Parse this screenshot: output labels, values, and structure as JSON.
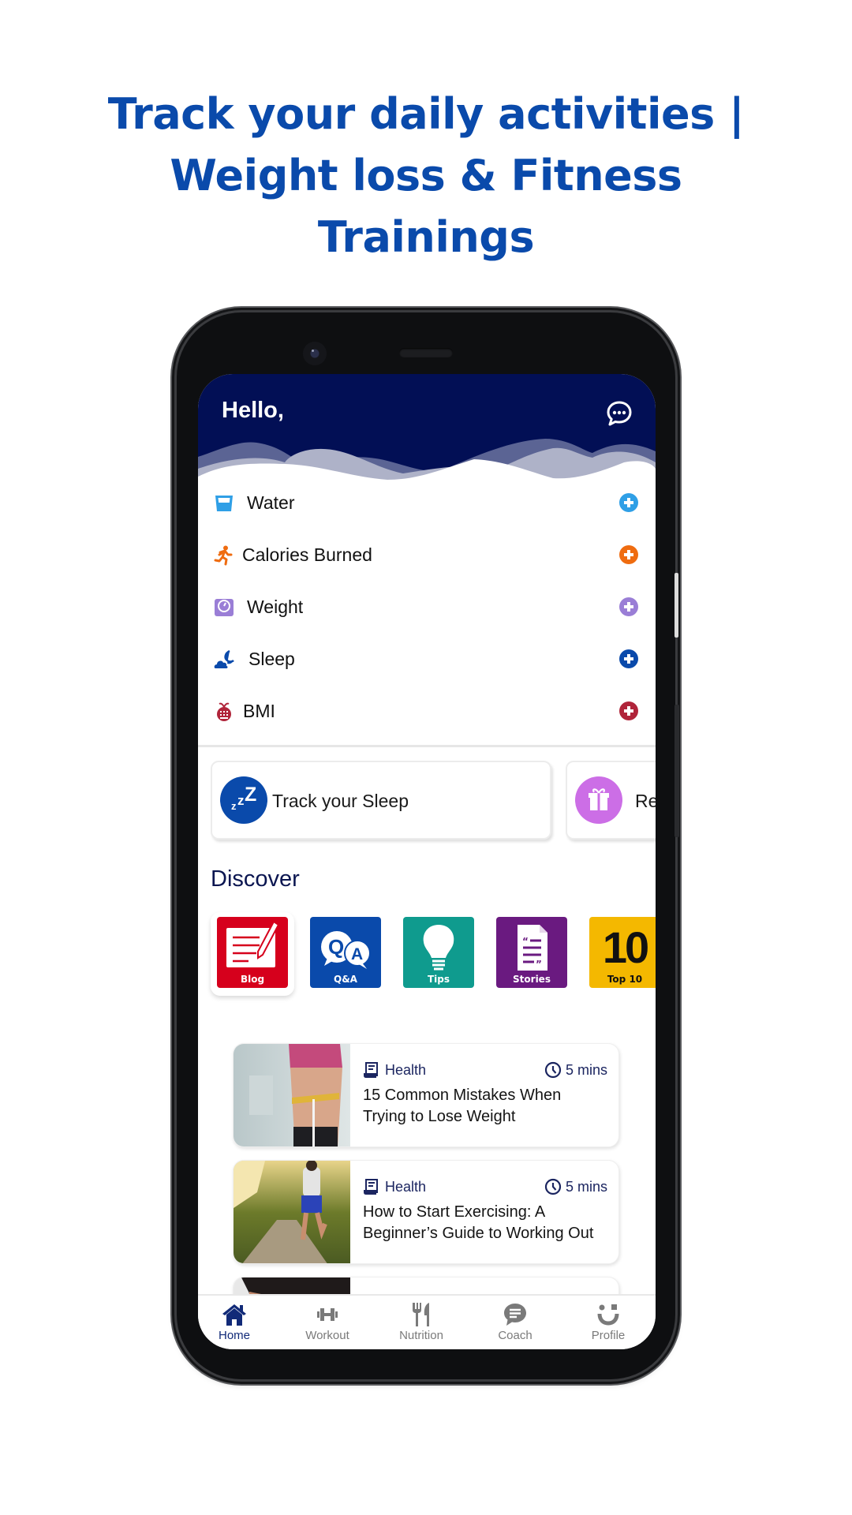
{
  "headline": {
    "lines": [
      "Track your daily activities |",
      "Weight loss & Fitness",
      "Trainings"
    ]
  },
  "header": {
    "greeting": "Hello,",
    "chat_icon": "chat-bubble-dots-icon",
    "background_color": "#020f55"
  },
  "tracker": {
    "items": [
      {
        "label": "Water",
        "icon": "water-glass-icon",
        "color": "#2f9fe6"
      },
      {
        "label": "Calories Burned",
        "icon": "running-person-icon",
        "color": "#ef6c10"
      },
      {
        "label": "Weight",
        "icon": "weighing-scale-icon",
        "color": "#9a7ed6"
      },
      {
        "label": "Sleep",
        "icon": "moon-cloud-icon",
        "color": "#0a4aab"
      },
      {
        "label": "BMI",
        "icon": "apple-calculator-icon",
        "color": "#b0243a"
      }
    ],
    "add_icon": "plus-circle-icon"
  },
  "cards": [
    {
      "label": "Track your Sleep",
      "icon": "zzz-icon",
      "color": "#0a4aab"
    },
    {
      "label": "Re",
      "icon": "gift-icon",
      "color": "#cc6ee6"
    }
  ],
  "discover": {
    "title": "Discover",
    "tiles": [
      {
        "label": "Blog",
        "icon": "notepad-pencil-icon",
        "color": "#d6001c"
      },
      {
        "label": "Q&A",
        "icon": "qa-bubbles-icon",
        "color": "#0a4aab"
      },
      {
        "label": "Tips",
        "icon": "lightbulb-icon",
        "color": "#0f9b8e"
      },
      {
        "label": "Stories",
        "icon": "document-quote-icon",
        "color": "#6a1a80"
      },
      {
        "label": "Top 10",
        "number": "10",
        "icon": "top-ten-icon",
        "color": "#f4b800"
      }
    ]
  },
  "articles": [
    {
      "category": "Health",
      "duration": "5 mins",
      "title": "15 Common Mistakes When Trying to Lose Weight"
    },
    {
      "category": "Health",
      "duration": "5 mins",
      "title": "How to Start Exercising: A Beginner’s Guide to Working Out"
    },
    {
      "category": "",
      "duration": "",
      "title": ""
    }
  ],
  "bottom_nav": {
    "items": [
      {
        "label": "Home",
        "icon": "home-icon",
        "active": true
      },
      {
        "label": "Workout",
        "icon": "dumbbell-icon",
        "active": false
      },
      {
        "label": "Nutrition",
        "icon": "fork-knife-icon",
        "active": false
      },
      {
        "label": "Coach",
        "icon": "chat-lines-icon",
        "active": false
      },
      {
        "label": "Profile",
        "icon": "smiley-profile-icon",
        "active": false
      }
    ],
    "active_color": "#112a78",
    "inactive_color": "#7a7a7a"
  }
}
